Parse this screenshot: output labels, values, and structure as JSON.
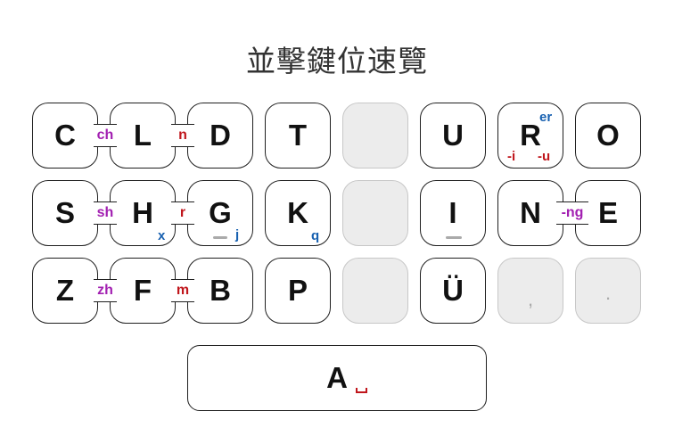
{
  "title": "並擊鍵位速覽",
  "keys": {
    "c": {
      "label": "C"
    },
    "l": {
      "label": "L"
    },
    "d": {
      "label": "D"
    },
    "t": {
      "label": "T"
    },
    "u": {
      "label": "U"
    },
    "r": {
      "label": "R",
      "sup": "er",
      "sub_left": "-i",
      "sub_right": "-u"
    },
    "o": {
      "label": "O"
    },
    "s": {
      "label": "S"
    },
    "h": {
      "label": "H",
      "sub": "x"
    },
    "g": {
      "label": "G",
      "sub": "j"
    },
    "k": {
      "label": "K",
      "sub": "q"
    },
    "i": {
      "label": "I"
    },
    "n": {
      "label": "N"
    },
    "e": {
      "label": "E"
    },
    "z": {
      "label": "Z"
    },
    "f": {
      "label": "F"
    },
    "b": {
      "label": "B"
    },
    "p": {
      "label": "P"
    },
    "uu": {
      "label": "Ü"
    },
    "comma": {
      "label": ","
    },
    "period": {
      "label": "."
    },
    "a": {
      "label": "A"
    }
  },
  "combos": {
    "ch": "ch",
    "n": "n",
    "sh": "sh",
    "r": "r",
    "ng": "-ng",
    "zh": "zh",
    "m": "m"
  },
  "colors": {
    "blue": "#1760b0",
    "red": "#c0161c",
    "purple": "#a21fb1",
    "key_border": "#1f1f1f",
    "empty_key_fill": "#ececec"
  }
}
